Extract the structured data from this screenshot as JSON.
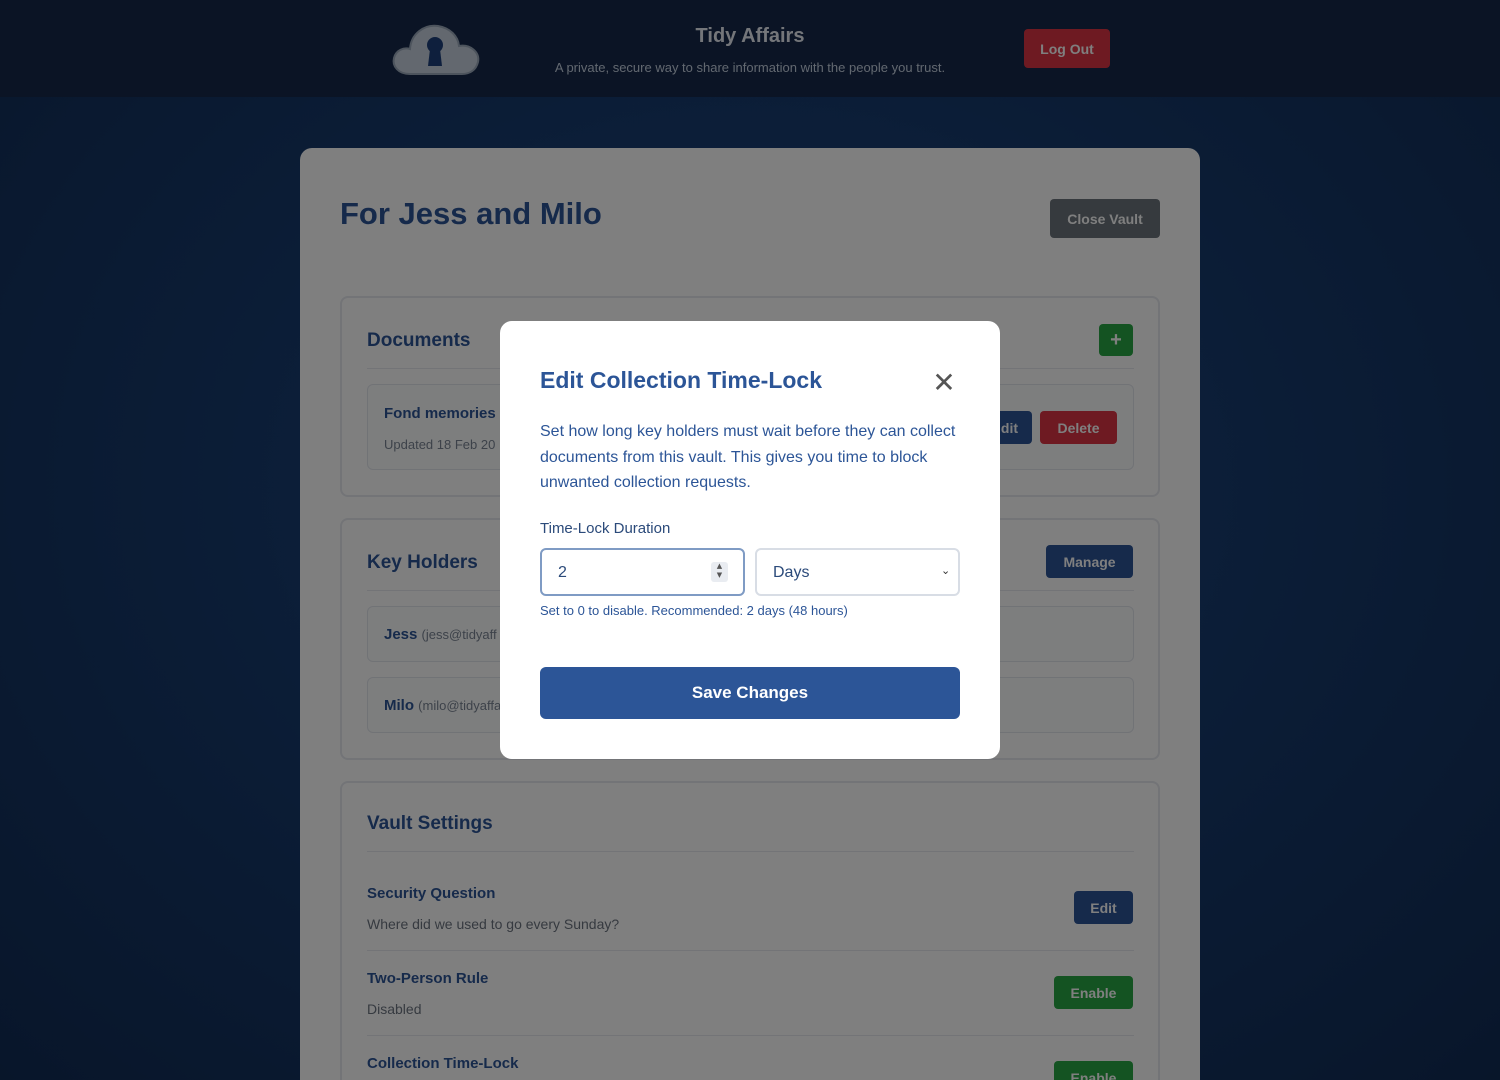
{
  "header": {
    "logo_icon": "cloud-keyhole-icon",
    "title": "Tidy Affairs",
    "tagline": "A private, secure way to share information with the people you trust.",
    "logout_label": "Log Out"
  },
  "vault": {
    "title": "For Jess and Milo",
    "close_label": "Close Vault"
  },
  "documents": {
    "title": "Documents",
    "add_label": "+",
    "items": [
      {
        "name": "Fond memories",
        "updated": "Updated 18 Feb 20",
        "edit_label": "dit",
        "delete_label": "Delete"
      }
    ]
  },
  "key_holders": {
    "title": "Key Holders",
    "manage_label": "Manage",
    "items": [
      {
        "name": "Jess",
        "email": "(jess@tidyaff"
      },
      {
        "name": "Milo",
        "email": "(milo@tidyaffa"
      }
    ]
  },
  "settings": {
    "title": "Vault Settings",
    "items": [
      {
        "name": "Security Question",
        "desc": "Where did we used to go every Sunday?",
        "action": "Edit"
      },
      {
        "name": "Two-Person Rule",
        "desc": "Disabled",
        "action": "Enable"
      },
      {
        "name": "Collection Time-Lock",
        "desc": "",
        "action": "Enable"
      }
    ]
  },
  "modal": {
    "title": "Edit Collection Time-Lock",
    "close_label": "✕",
    "description": "Set how long key holders must wait before they can collect documents from this vault. This gives you time to block unwanted collection requests.",
    "field_label": "Time-Lock Duration",
    "duration_value": "2",
    "unit_value": "Days",
    "help_text": "Set to 0 to disable. Recommended: 2 days (48 hours)",
    "save_label": "Save Changes"
  },
  "colors": {
    "primary": "#2c5597",
    "danger": "#dc3545",
    "success": "#28a745",
    "secondary": "#6c757d",
    "header_bg": "#16294a"
  }
}
